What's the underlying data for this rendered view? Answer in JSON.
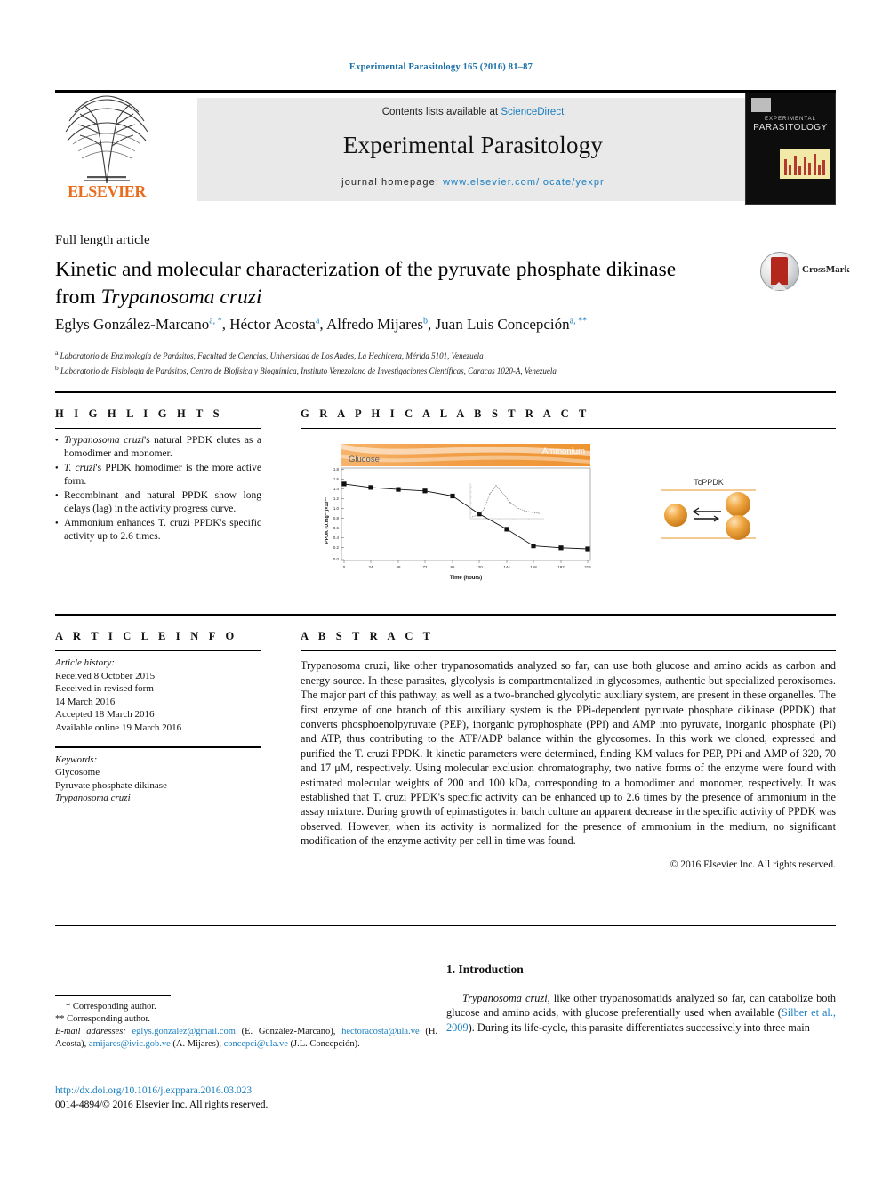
{
  "running_head": "Experimental Parasitology 165 (2016) 81–87",
  "masthead": {
    "publisher": "ELSEVIER",
    "contents_prefix": "Contents lists available at",
    "contents_link": "ScienceDirect",
    "journal_title": "Experimental Parasitology",
    "homepage_prefix": "journal homepage:",
    "homepage_url": "www.elsevier.com/locate/yexpr",
    "cover": {
      "line1": "EXPERIMENTAL",
      "line2": "PARASITOLOGY"
    }
  },
  "article": {
    "type": "Full length article",
    "title_part1": "Kinetic and molecular characterization of the pyruvate phosphate",
    "title_part2": "dikinase from ",
    "title_italic": "Trypanosoma cruzi",
    "crossmark_label": "CrossMark",
    "authors": [
      {
        "name": "Eglys González-Marcano",
        "sup": "a, *"
      },
      {
        "name": "Héctor Acosta",
        "sup": "a"
      },
      {
        "name": "Alfredo Mijares",
        "sup": "b"
      },
      {
        "name": "Juan Luis Concepción",
        "sup": "a, **"
      }
    ],
    "affiliations": [
      {
        "marker": "a",
        "text": "Laboratorio de Enzimología de Parásitos, Facultad de Ciencias, Universidad de Los Andes, La Hechicera, Mérida 5101, Venezuela"
      },
      {
        "marker": "b",
        "text": "Laboratorio de Fisiología de Parásitos, Centro de Biofísica y Bioquímica, Instituto Venezolano de Investigaciones Científicas, Caracas 1020-A, Venezuela"
      }
    ]
  },
  "sections": {
    "highlights_label": "H I G H L I G H T S",
    "graphical_abstract_label": "G R A P H I C A L   A B S T R A C T",
    "article_info_label": "A R T I C L E   I N F O",
    "abstract_label": "A B S T R A C T"
  },
  "highlights": [
    {
      "italic_lead": "Trypanosoma cruzi",
      "rest": "'s natural PPDK elutes as a homodimer and monomer."
    },
    {
      "italic_lead": "T. cruzi",
      "rest": "'s PPDK homodimer is the more active form."
    },
    {
      "italic_lead": "",
      "rest": "Recombinant and natural PPDK show long delays (lag) in the activity progress curve."
    },
    {
      "italic_lead": "",
      "rest": "Ammonium enhances T. cruzi PPDK's specific activity up to 2.6 times."
    }
  ],
  "article_info": {
    "history_label": "Article history:",
    "history": [
      "Received 8 October 2015",
      "Received in revised form",
      "14 March 2016",
      "Accepted 18 March 2016",
      "Available online 19 March 2016"
    ],
    "keywords_label": "Keywords:",
    "keywords": [
      "Glycosome",
      "Pyruvate phosphate dikinase",
      "Trypanosoma cruzi"
    ]
  },
  "abstract": {
    "text": "Trypanosoma cruzi, like other trypanosomatids analyzed so far, can use both glucose and amino acids as carbon and energy source. In these parasites, glycolysis is compartmentalized in glycosomes, authentic but specialized peroxisomes. The major part of this pathway, as well as a two-branched glycolytic auxiliary system, are present in these organelles. The first enzyme of one branch of this auxiliary system is the PPi-dependent pyruvate phosphate dikinase (PPDK) that converts phosphoenolpyruvate (PEP), inorganic pyrophosphate (PPi) and AMP into pyruvate, inorganic phosphate (Pi) and ATP, thus contributing to the ATP/ADP balance within the glycosomes. In this work we cloned, expressed and purified the T. cruzi PPDK. It kinetic parameters were determined, finding KM values for PEP, PPi and AMP of 320, 70 and 17 μM, respectively. Using molecular exclusion chromatography, two native forms of the enzyme were found with estimated molecular weights of 200 and 100 kDa, corresponding to a homodimer and monomer, respectively. It was established that T. cruzi PPDK's specific activity can be enhanced up to 2.6 times by the presence of ammonium in the assay mixture. During growth of epimastigotes in batch culture an apparent decrease in the specific activity of PPDK was observed. However, when its activity is normalized for the presence of ammonium in the medium, no significant modification of the enzyme activity per cell in time was found.",
    "copyright": "© 2016 Elsevier Inc. All rights reserved."
  },
  "chart_data": {
    "type": "line",
    "title": "",
    "xlabel": "Time (hours)",
    "ylabel": "PPDK (U.mg⁻¹)×10⁻¹",
    "x": [
      0,
      24,
      48,
      72,
      96,
      120,
      144,
      168,
      192,
      216
    ],
    "values": [
      1.52,
      1.45,
      1.41,
      1.38,
      1.28,
      0.92,
      0.62,
      0.29,
      0.25,
      0.23
    ],
    "xticks": [
      "0",
      "24",
      "48",
      "72",
      "96",
      "120",
      "144",
      "168",
      "192",
      "216"
    ],
    "yticks": [
      "0.0",
      "0.2",
      "0.4",
      "0.6",
      "0.8",
      "1.0",
      "1.2",
      "1.4",
      "1.6",
      "1.8"
    ],
    "xlim": [
      0,
      216
    ],
    "ylim": [
      0.0,
      1.8
    ],
    "grid": false,
    "legend": "none",
    "banner_left": "Glucose",
    "banner_right": "Ammonium",
    "annotation": "TcPPDK",
    "inset": {
      "type": "line",
      "description": "small inset curve with sharp peak",
      "x": [
        0,
        1,
        2,
        3,
        4,
        5,
        6,
        7,
        8,
        9,
        10
      ],
      "values": [
        0.05,
        0.1,
        0.3,
        0.85,
        1.0,
        0.72,
        0.5,
        0.38,
        0.32,
        0.3,
        0.29
      ]
    },
    "colors": {
      "banner": "#F5A04B",
      "marker": "#111111",
      "sphere": "#E8952E"
    }
  },
  "footnotes": {
    "corresponding1": "* Corresponding author.",
    "corresponding2": "** Corresponding author.",
    "email_label": "E-mail addresses:",
    "emails": [
      {
        "address": "eglys.gonzalez@gmail.com",
        "owner": "(E. González-Marcano),"
      },
      {
        "address": "hectoracosta@ula.ve",
        "owner": "(H. Acosta),"
      },
      {
        "address": "amijares@ivic.gob.ve",
        "owner": "(A. Mijares),"
      },
      {
        "address": "concepci@ula.ve",
        "owner": "(J.L. Concepción)."
      }
    ]
  },
  "footer": {
    "doi": "http://dx.doi.org/10.1016/j.exppara.2016.03.023",
    "issn_line": "0014-4894/© 2016 Elsevier Inc. All rights reserved."
  },
  "introduction": {
    "heading": "1. Introduction",
    "lead_italic": "Trypanosoma cruzi",
    "body_part1": ", like other trypanosomatids analyzed so far, can catabolize both glucose and amino acids, with glucose preferentially used when available (",
    "citation": "Silber et al., 2009",
    "body_part2": "). During its life-cycle, this parasite differentiates successively into three main"
  }
}
